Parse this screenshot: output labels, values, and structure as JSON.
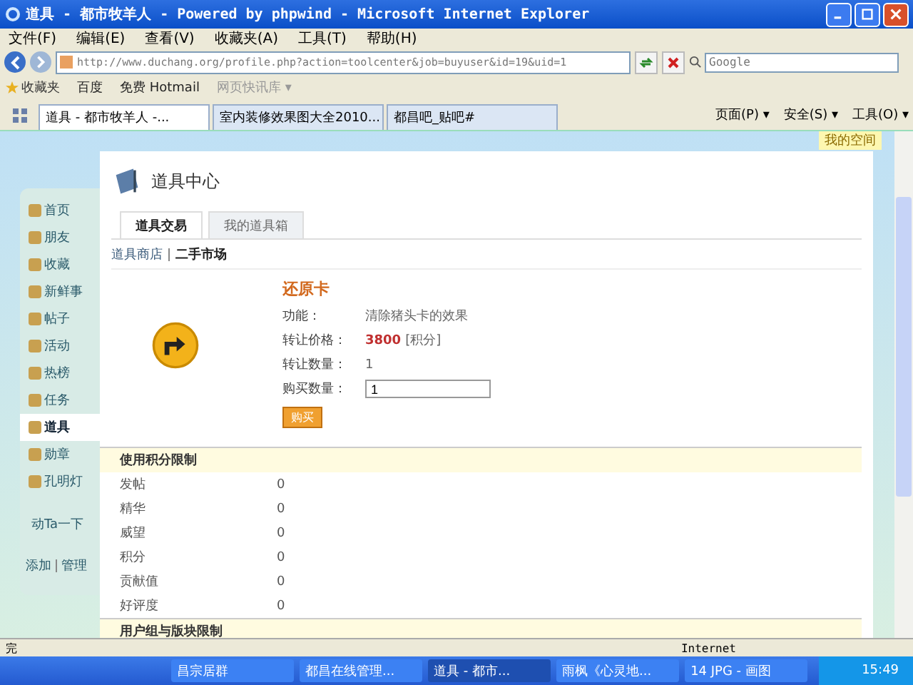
{
  "window": {
    "title": "道具 - 都市牧羊人 - Powered by phpwind - Microsoft Internet Explorer"
  },
  "menu": [
    "文件(F)",
    "编辑(E)",
    "查看(V)",
    "收藏夹(A)",
    "工具(T)",
    "帮助(H)"
  ],
  "address": {
    "value": "http://www.duchang.org/profile.php?action=toolcenter&job=buyuser&id=19&uid=1"
  },
  "search": {
    "placeholder": "Google"
  },
  "favorites": {
    "label": "收藏夹",
    "links": [
      "百度",
      "免费 Hotmail",
      "网页快讯库 ▾"
    ]
  },
  "browser_tabs": [
    {
      "label": "道具 - 都市牧羊人 -...",
      "selected": true
    },
    {
      "label": "室内装修效果图大全2010...",
      "selected": false
    },
    {
      "label": "都昌吧_贴吧#",
      "selected": false
    }
  ],
  "browser_tools": [
    "页面(P) ▾",
    "安全(S) ▾",
    "工具(O) ▾"
  ],
  "space_badge": "我的空间",
  "sidebar": {
    "items": [
      {
        "label": "首页",
        "selected": false
      },
      {
        "label": "朋友",
        "selected": false
      },
      {
        "label": "收藏",
        "selected": false
      },
      {
        "label": "新鲜事",
        "selected": false
      },
      {
        "label": "帖子",
        "selected": false
      },
      {
        "label": "活动",
        "selected": false
      },
      {
        "label": "热榜",
        "selected": false
      },
      {
        "label": "任务",
        "selected": false
      },
      {
        "label": "道具",
        "selected": true
      },
      {
        "label": "勋章",
        "selected": false
      },
      {
        "label": "孔明灯",
        "selected": false
      }
    ],
    "poke": "动Ta一下",
    "add": "添加",
    "manage": "管理"
  },
  "panel": {
    "title": "道具中心",
    "tabs": [
      {
        "label": "道具交易",
        "selected": true
      },
      {
        "label": "我的道具箱",
        "selected": false
      }
    ],
    "subnav": [
      {
        "label": "道具商店",
        "selected": false
      },
      {
        "label": "二手市场",
        "selected": true
      }
    ],
    "item": {
      "name": "还原卡",
      "function_label": "功能：",
      "function": "清除猪头卡的效果",
      "price_label": "转让价格：",
      "price": "3800",
      "price_unit": "[积分]",
      "quantity_label": "转让数量：",
      "quantity": "1",
      "buy_label": "购买数量：",
      "buy_value": "1",
      "buy_button": "购买"
    },
    "limits": {
      "title": "使用积分限制",
      "rows": [
        {
          "name": "发帖",
          "value": "0"
        },
        {
          "name": "精华",
          "value": "0"
        },
        {
          "name": "威望",
          "value": "0"
        },
        {
          "name": "积分",
          "value": "0"
        },
        {
          "name": "贡献值",
          "value": "0"
        },
        {
          "name": "好评度",
          "value": "0"
        }
      ]
    },
    "group_limits": {
      "title": "用户组与版块限制"
    }
  },
  "status_bar": {
    "text": "完",
    "zone": "Internet"
  },
  "taskbar": {
    "items": [
      {
        "label": "昌宗居群",
        "selected": false
      },
      {
        "label": "都昌在线管理...",
        "selected": false
      },
      {
        "label": "道具 - 都市...",
        "selected": true
      },
      {
        "label": "雨枫《心灵地...",
        "selected": false
      },
      {
        "label": "14 JPG - 画图",
        "selected": false
      }
    ],
    "clock": "15:49"
  }
}
